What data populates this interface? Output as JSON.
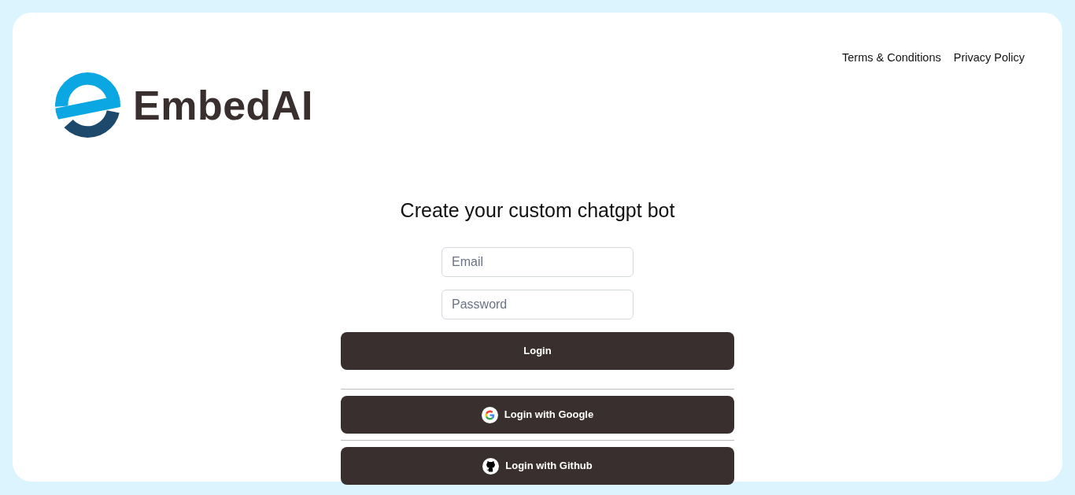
{
  "header": {
    "brand": "EmbedAI",
    "links": [
      {
        "label": "Terms & Conditions"
      },
      {
        "label": "Privacy Policy"
      }
    ]
  },
  "form": {
    "heading": "Create your custom chatgpt bot",
    "fields": [
      {
        "placeholder": "Email"
      },
      {
        "placeholder": "Password"
      }
    ],
    "submit": "Login",
    "providers": [
      {
        "kind": "google",
        "label": "Login with Google"
      },
      {
        "kind": "github",
        "label": "Login with Github"
      }
    ]
  }
}
